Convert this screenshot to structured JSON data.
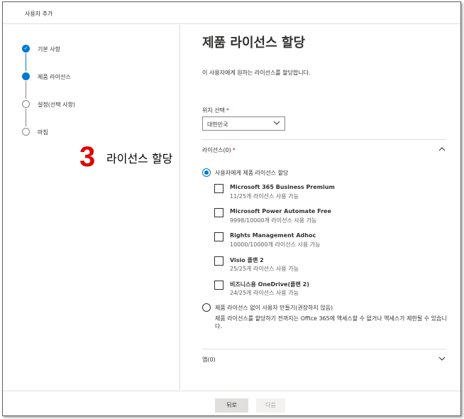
{
  "window": {
    "title": "사용자 추가"
  },
  "steps": [
    {
      "label": "기본 사항",
      "state": "done"
    },
    {
      "label": "제품 라이선스",
      "state": "current"
    },
    {
      "label": "설정(선택 사항)",
      "state": "todo"
    },
    {
      "label": "마침",
      "state": "todo"
    }
  ],
  "annotation": {
    "number": "3",
    "text": "라이선스 할당"
  },
  "main": {
    "heading": "제품 라이선스 할당",
    "description": "이 사용자에게 원하는 라이선스를 할당합니다."
  },
  "location": {
    "label": "위치 선택",
    "required_mark": "*",
    "value": "대한민국"
  },
  "licenses_section": {
    "title": "라이선스(0)",
    "required_mark": "*",
    "options": [
      {
        "label": "사용자에게 제품 라이선스 할당",
        "checked": true
      },
      {
        "label": "제품 라이선스 없이 사용자 만들기(권장하지 않음)",
        "checked": false,
        "note": "제품 라이선스를 할당하기 전까지는 Office 365에 액세스할 수 없거나 액세스가 제한될 수 있습니다."
      }
    ],
    "licenses": [
      {
        "name": "Microsoft 365 Business Premium",
        "availability": "11/25개 라이선스 사용 가능"
      },
      {
        "name": "Microsoft Power Automate Free",
        "availability": "9998/10000개 라이선스 사용 가능"
      },
      {
        "name": "Rights Management Adhoc",
        "availability": "10000/10000개 라이선스 사용 가능"
      },
      {
        "name": "Visio 플랜 2",
        "availability": "25/25개 라이선스 사용 가능"
      },
      {
        "name": "비즈니스용 OneDrive(플랜 2)",
        "availability": "24/25개 라이선스 사용 가능"
      }
    ]
  },
  "apps_section": {
    "title": "앱(0)"
  },
  "footer": {
    "back_label": "뒤로",
    "next_label": "다음"
  },
  "colors": {
    "accent": "#0078d4",
    "annotation": "#e00000",
    "required": "#a4262c"
  }
}
